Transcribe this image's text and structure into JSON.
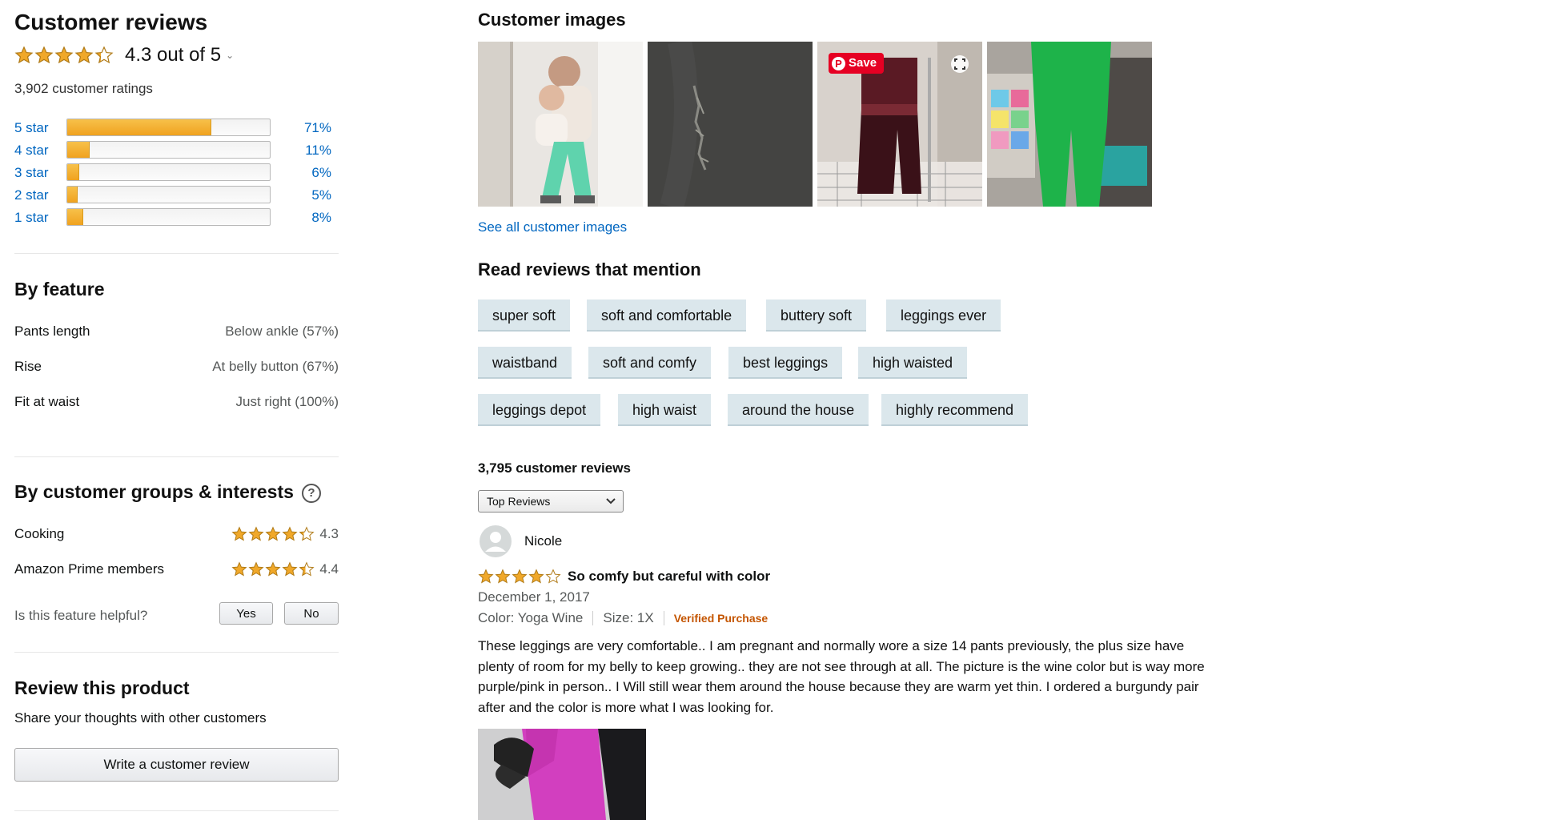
{
  "summary": {
    "title": "Customer reviews",
    "rating_text": "4.3 out of 5",
    "rating_value": 4.3,
    "total_ratings": "3,902 customer ratings",
    "histogram": [
      {
        "label": "5 star",
        "percent_text": "71%",
        "percent": 71
      },
      {
        "label": "4 star",
        "percent_text": "11%",
        "percent": 11
      },
      {
        "label": "3 star",
        "percent_text": "6%",
        "percent": 6
      },
      {
        "label": "2 star",
        "percent_text": "5%",
        "percent": 5
      },
      {
        "label": "1 star",
        "percent_text": "8%",
        "percent": 8
      }
    ]
  },
  "by_feature": {
    "title": "By feature",
    "items": [
      {
        "name": "Pants length",
        "value": "Below ankle  (57%)"
      },
      {
        "name": "Rise",
        "value": "At belly button  (67%)"
      },
      {
        "name": "Fit at waist",
        "value": "Just right  (100%)"
      }
    ]
  },
  "groups": {
    "title": "By customer groups & interests",
    "help_icon": "question-circle-icon",
    "items": [
      {
        "name": "Cooking",
        "score": "4.3",
        "rating": 4.3
      },
      {
        "name": "Amazon Prime members",
        "score": "4.4",
        "rating": 4.4
      }
    ],
    "helpful_question": "Is this feature helpful?",
    "yes_label": "Yes",
    "no_label": "No"
  },
  "review_product": {
    "title": "Review this product",
    "subtitle": "Share your thoughts with other customers",
    "button_label": "Write a customer review"
  },
  "images": {
    "title": "Customer images",
    "see_all": "See all customer images",
    "save_label": "Save"
  },
  "mentions": {
    "title": "Read reviews that mention",
    "tags": [
      "super soft",
      "soft and comfortable",
      "buttery soft",
      "leggings ever",
      "waistband",
      "soft and comfy",
      "best leggings",
      "high waisted",
      "leggings depot",
      "high waist",
      "around the house",
      "highly recommend"
    ]
  },
  "reviews": {
    "count_text": "3,795 customer reviews",
    "sort_selected": "Top Reviews",
    "first": {
      "author": "Nicole",
      "rating": 4,
      "title": "So comfy but careful with color",
      "date": "December 1, 2017",
      "color": "Color: Yoga Wine",
      "size": "Size: 1X",
      "verified": "Verified Purchase",
      "body": "These leggings are very comfortable.. I am pregnant and normally wore a size 14 pants previously, the plus size have plenty of room for my belly to keep growing.. they are not see through at all. The picture is the wine color but is way more purple/pink in person.. I Will still wear them around the house because they are warm yet thin. I ordered a burgundy pair after and the color is more what I was looking for."
    }
  },
  "colors": {
    "link": "#0066c0",
    "star": "#f0a82a",
    "verified": "#c45500",
    "tag_bg": "#dbe7ec",
    "pinterest": "#e60023"
  }
}
